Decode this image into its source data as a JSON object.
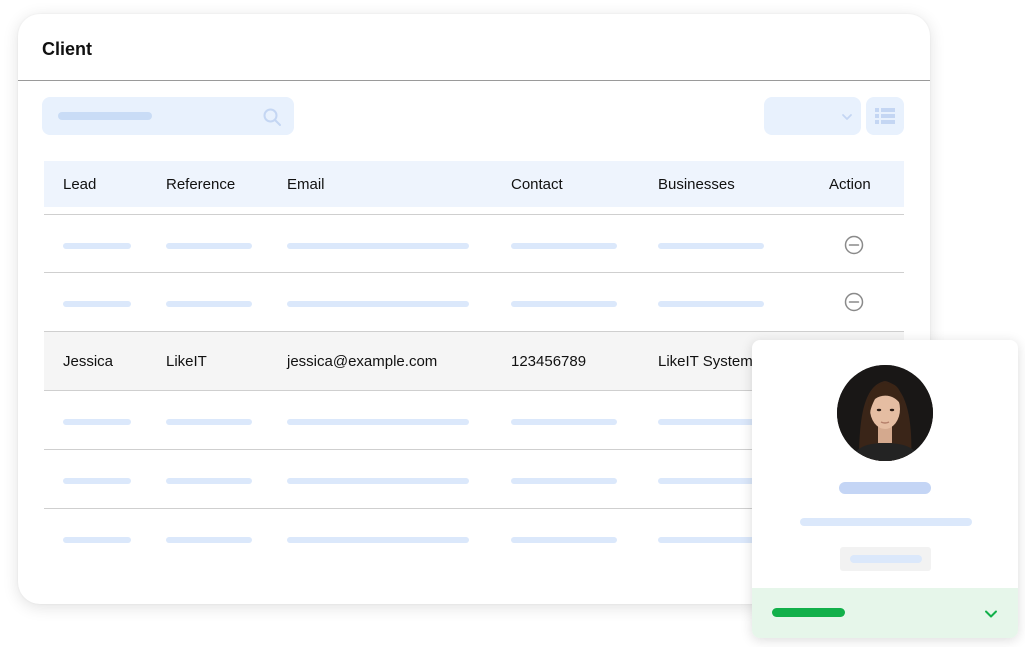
{
  "card": {
    "title": "Client"
  },
  "table": {
    "headers": {
      "lead": "Lead",
      "reference": "Reference",
      "email": "Email",
      "contact": "Contact",
      "businesses": "Businesses",
      "action": "Action"
    },
    "highlighted_row": {
      "lead": "Jessica",
      "reference": "LikeIT",
      "email": "jessica@example.com",
      "contact": "123456789",
      "businesses": "LikeIT Systems"
    }
  },
  "icons": {
    "search": "search-icon",
    "dropdown": "chevron-down-icon",
    "list_view": "list-view-icon",
    "remove": "minus-circle-icon",
    "profile_chevron": "chevron-down-icon"
  },
  "colors": {
    "accent_light": "#e8f1fd",
    "placeholder": "#dbe8fb",
    "status_green": "#12b04a",
    "footer_green": "#e6f6ea"
  }
}
